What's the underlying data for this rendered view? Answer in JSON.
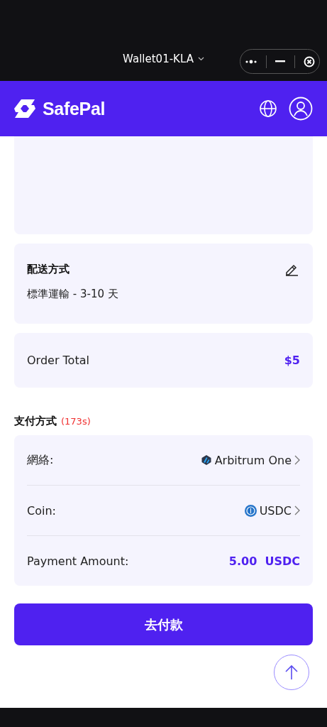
{
  "top_bar": {
    "wallet_name": "Wallet01-KLA"
  },
  "header": {
    "brand": "SafePal"
  },
  "shipping": {
    "title": "配送方式",
    "value": "標準運輸 - 3-10 天"
  },
  "order_total": {
    "label": "Order Total",
    "value": "$5"
  },
  "payment": {
    "title": "支付方式",
    "countdown": "(173s)",
    "rows": [
      {
        "kind": "select",
        "label": "網絡:",
        "value": "Arbitrum One"
      },
      {
        "kind": "select",
        "label": "Coin:",
        "value": "USDC"
      },
      {
        "kind": "amount",
        "label": "Payment Amount:",
        "value": "5.00  USDC"
      }
    ]
  },
  "pay_button": {
    "label": "去付款"
  }
}
